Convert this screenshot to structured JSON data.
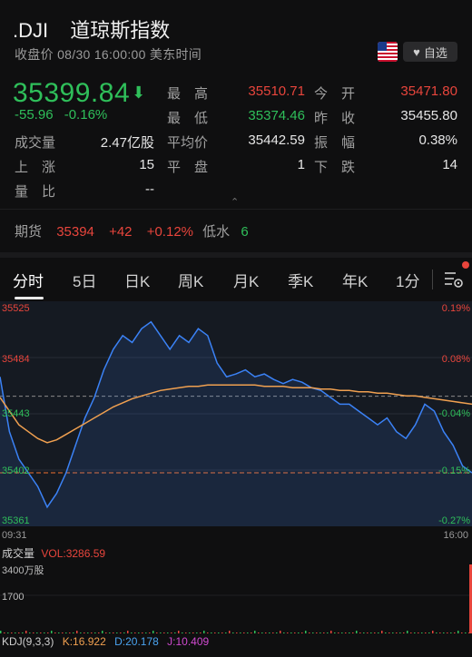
{
  "header": {
    "symbol": ".DJI",
    "name": "道琼斯指数",
    "status": "收盘价 08/30 16:00:00 美东时间",
    "flag_icon": "us-flag-icon",
    "watchlist_label": "自选"
  },
  "quote": {
    "price": "35399.84",
    "change": "-55.96",
    "change_pct": "-0.16%",
    "fields": [
      {
        "label": "最　高",
        "value": "35510.71",
        "color": "red"
      },
      {
        "label": "今　开",
        "value": "35471.80",
        "color": "red"
      },
      {
        "label": "最　低",
        "value": "35374.46",
        "color": "green"
      },
      {
        "label": "昨　收",
        "value": "35455.80",
        "color": "white"
      },
      {
        "label": "成交量",
        "value": "2.47亿股",
        "color": "white"
      },
      {
        "label": "平均价",
        "value": "35442.59",
        "color": "white"
      },
      {
        "label": "振　幅",
        "value": "0.38%",
        "color": "white"
      },
      {
        "label": "上　涨",
        "value": "15",
        "color": "white"
      },
      {
        "label": "平　盘",
        "value": "1",
        "color": "white"
      },
      {
        "label": "下　跌",
        "value": "14",
        "color": "white"
      },
      {
        "label": "量　比",
        "value": "--",
        "color": "white"
      }
    ]
  },
  "futures": {
    "label": "期货",
    "price": "35394",
    "change": "+42",
    "change_pct": "+0.12%",
    "basis_label": "低水",
    "basis_value": "6"
  },
  "tabs": [
    "分时",
    "5日",
    "日K",
    "周K",
    "月K",
    "季K",
    "年K",
    "1分"
  ],
  "active_tab": "分时",
  "chart": {
    "y_left": [
      "35525",
      "35484",
      "35443",
      "35402",
      "35361"
    ],
    "y_right": [
      "0.19%",
      "0.08%",
      "-0.04%",
      "-0.15%",
      "-0.27%"
    ],
    "time_start": "09:31",
    "time_end": "16:00",
    "colors": {
      "price": "#3b82f6",
      "avg": "#f0a050",
      "up": "#e8453c",
      "down": "#2fbf5a"
    }
  },
  "volume": {
    "label": "成交量",
    "vol_text": "VOL:3286.59",
    "y_top": "3400万股",
    "y_mid": "1700"
  },
  "kdj": {
    "label": "KDJ(9,3,3)",
    "k": "K:16.922",
    "d": "D:20.178",
    "j": "J:10.409"
  },
  "chart_data": {
    "type": "line",
    "x_range": [
      "09:31",
      "16:00"
    ],
    "ylim": [
      35361,
      35525
    ],
    "prev_close": 35455.8,
    "series": [
      {
        "values": [
          35470,
          35430,
          35410,
          35400,
          35390,
          35375,
          35385,
          35400,
          35420,
          35440,
          35455,
          35475,
          35490,
          35500,
          35495,
          35505,
          35510,
          35500,
          35490,
          35500,
          35495,
          35505,
          35500,
          35480,
          35470,
          35472,
          35475,
          35470,
          35472,
          35468,
          35465,
          35468,
          35466,
          35462,
          35460,
          35455,
          35450,
          35450,
          35445,
          35440,
          35435,
          35440,
          35430,
          35425,
          35435,
          35450,
          35445,
          35430,
          35420,
          35405,
          35400
        ]
      },
      {
        "values": [
          35455,
          35445,
          35435,
          35430,
          35425,
          35422,
          35424,
          35428,
          35432,
          35436,
          35440,
          35444,
          35448,
          35451,
          35454,
          35456,
          35458,
          35460,
          35461,
          35462,
          35463,
          35463,
          35464,
          35464,
          35464,
          35464,
          35464,
          35464,
          35463,
          35463,
          35463,
          35462,
          35462,
          35462,
          35461,
          35461,
          35460,
          35460,
          35459,
          35459,
          35458,
          35458,
          35457,
          35456,
          35456,
          35455,
          35454,
          35453,
          35452,
          35451,
          35450
        ]
      }
    ]
  }
}
